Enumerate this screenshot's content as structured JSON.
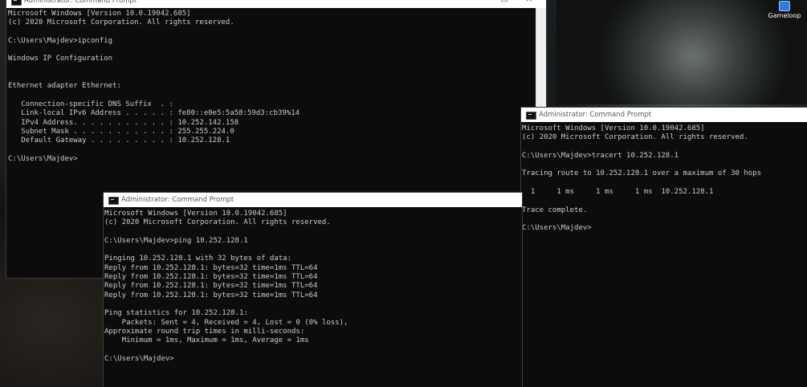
{
  "desktop": {
    "icon_label": "Gameloop"
  },
  "window_ipconfig": {
    "title": "Administrator: Command Prompt",
    "controls": {
      "minimize": "—",
      "maximize": "☐",
      "close": "✕"
    },
    "lines": [
      "Microsoft Windows [Version 10.0.19042.685]",
      "(c) 2020 Microsoft Corporation. All rights reserved.",
      "",
      "C:\\Users\\Majdev>ipconfig",
      "",
      "Windows IP Configuration",
      "",
      "",
      "Ethernet adapter Ethernet:",
      "",
      "   Connection-specific DNS Suffix  . :",
      "   Link-local IPv6 Address . . . . . : fe80::e0e5:5a58:59d3:cb39%14",
      "   IPv4 Address. . . . . . . . . . . : 10.252.142.158",
      "   Subnet Mask . . . . . . . . . . . : 255.255.224.0",
      "   Default Gateway . . . . . . . . . : 10.252.128.1",
      "",
      "C:\\Users\\Majdev>"
    ]
  },
  "window_ping": {
    "title": "Administrator: Command Prompt",
    "lines": [
      "Microsoft Windows [Version 10.0.19042.685]",
      "(c) 2020 Microsoft Corporation. All rights reserved.",
      "",
      "C:\\Users\\Majdev>ping 10.252.128.1",
      "",
      "Pinging 10.252.128.1 with 32 bytes of data:",
      "Reply from 10.252.128.1: bytes=32 time=1ms TTL=64",
      "Reply from 10.252.128.1: bytes=32 time=1ms TTL=64",
      "Reply from 10.252.128.1: bytes=32 time=1ms TTL=64",
      "Reply from 10.252.128.1: bytes=32 time=1ms TTL=64",
      "",
      "Ping statistics for 10.252.128.1:",
      "    Packets: Sent = 4, Received = 4, Lost = 0 (0% loss),",
      "Approximate round trip times in milli-seconds:",
      "    Minimum = 1ms, Maximum = 1ms, Average = 1ms",
      "",
      "C:\\Users\\Majdev>"
    ]
  },
  "window_tracert": {
    "title": "Administrator: Command Prompt",
    "lines": [
      "Microsoft Windows [Version 10.0.19042.685]",
      "(c) 2020 Microsoft Corporation. All rights reserved.",
      "",
      "C:\\Users\\Majdev>tracert 10.252.128.1",
      "",
      "Tracing route to 10.252.128.1 over a maximum of 30 hops",
      "",
      "  1     1 ms     1 ms     1 ms  10.252.128.1",
      "",
      "Trace complete.",
      "",
      "C:\\Users\\Majdev>"
    ]
  }
}
